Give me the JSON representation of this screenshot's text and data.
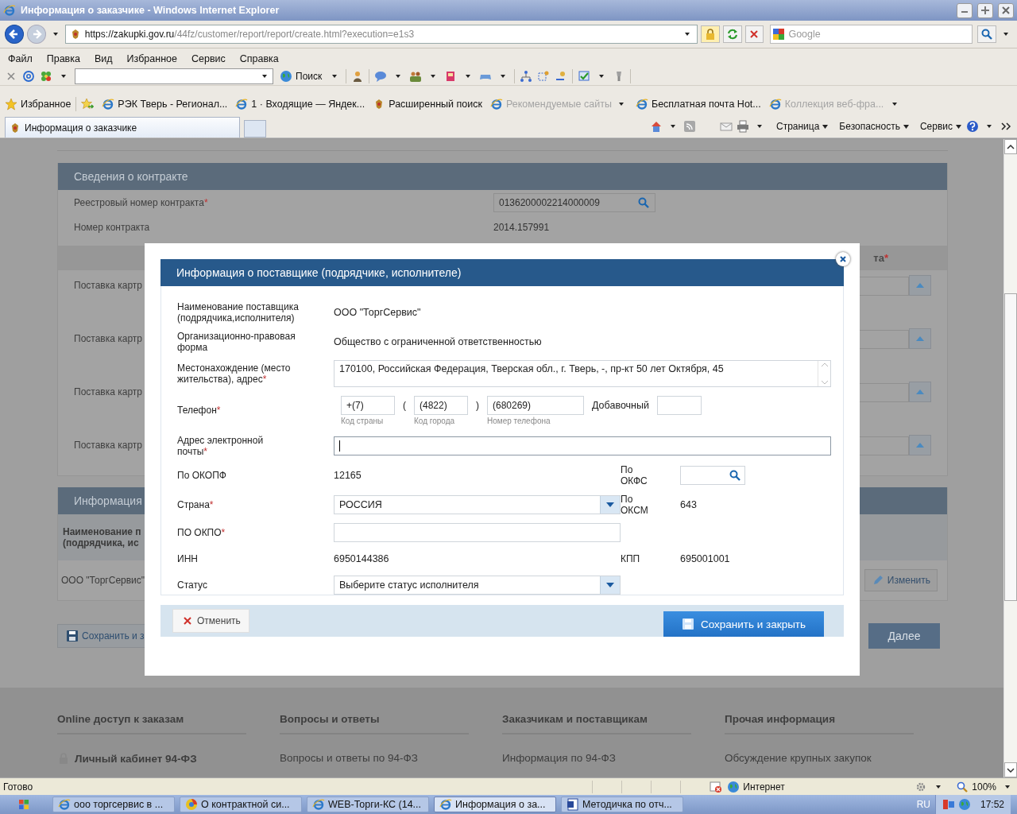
{
  "window": {
    "title": "Информация о заказчике - Windows Internet Explorer"
  },
  "address_bar": {
    "scheme": "https://",
    "host": "zakupki.gov.ru",
    "path": "/44fz/customer/report/report/create.html?execution=e1s3"
  },
  "search_box": {
    "placeholder": "Google"
  },
  "menu": [
    "Файл",
    "Правка",
    "Вид",
    "Избранное",
    "Сервис",
    "Справка"
  ],
  "toolbar": {
    "search_label": "Поиск"
  },
  "favorites_bar": {
    "label": "Избранное",
    "links": [
      {
        "label": "РЭК Тверь - Регионал...",
        "dimmed": false,
        "dropdown": false
      },
      {
        "label": "1 · Входящие — Яндек...",
        "dimmed": false,
        "dropdown": false
      },
      {
        "label": "Расширенный поиск",
        "dimmed": false,
        "dropdown": false
      },
      {
        "label": "Рекомендуемые сайты",
        "dimmed": true,
        "dropdown": true
      },
      {
        "label": "Бесплатная почта Hot...",
        "dimmed": false,
        "dropdown": false
      },
      {
        "label": "Коллекция веб-фра...",
        "dimmed": true,
        "dropdown": false
      }
    ]
  },
  "tabs": [
    {
      "label": "Информация о заказчике",
      "selected": true
    }
  ],
  "command_bar": [
    "Страница",
    "Безопасность",
    "Сервис"
  ],
  "page": {
    "contract_section": {
      "title": "Сведения о контракте",
      "fields": [
        {
          "kind": "search",
          "label": "Реестровый номер контракта",
          "required": "*",
          "value": "0136200002214000009"
        },
        {
          "kind": "text",
          "label": "Номер контракта",
          "value": "2014.157991"
        }
      ]
    },
    "objects_table": {
      "header_fragment": "та",
      "header_required": "*",
      "rows": [
        "Поставка картр",
        "Поставка картр",
        "Поставка картр",
        "Поставка картр"
      ]
    },
    "supplier_section": {
      "title": "Информация",
      "column_1": "Наименование п\n(подрядчика, ис",
      "rows": [
        {
          "supplier": "ООО \"ТоргСервис\"",
          "action": "Изменить"
        }
      ]
    },
    "buttons": {
      "save": "Сохранить и з",
      "next": "Далее"
    },
    "footer": [
      {
        "title": "Online доступ к заказам",
        "link": "Личный кабинет 94-ФЗ",
        "locked": true
      },
      {
        "title": "Вопросы и ответы",
        "link": "Вопросы и ответы по 94-ФЗ",
        "locked": false
      },
      {
        "title": "Заказчикам и поставщикам",
        "link": "Информация по 94-ФЗ",
        "locked": false
      },
      {
        "title": "Прочая информация",
        "link": "Обсуждение крупных закупок",
        "locked": false
      }
    ]
  },
  "supplier_dialog": {
    "title": "Информация о поставщике (подрядчике, исполнителе)",
    "fields": [
      {
        "kind": "text",
        "label": "Наименование поставщика\n(подрядчика,исполнителя)",
        "value": "ООО \"ТоргСервис\""
      },
      {
        "kind": "text",
        "label": "Организационно-правовая\nформа",
        "value": "Общество с ограниченной ответственностью"
      },
      {
        "kind": "textarea",
        "label": "Местонахождение (место\nжительства), адрес",
        "required": "*",
        "value": "170100, Российская Федерация, Тверская обл., г. Тверь, -, пр-кт 50 лет Октября, 45"
      },
      {
        "kind": "phone",
        "label": "Телефон",
        "required": "*",
        "parts": [
          {
            "value": "+(7)",
            "hint": "Код страны"
          },
          {
            "separator": "(",
            "value": "(4822)",
            "hint": "Код города"
          },
          {
            "separator": ")",
            "value": "(680269)",
            "hint": "Номер телефона"
          }
        ],
        "extension_label": "Добавочный"
      },
      {
        "kind": "input",
        "label": "Адрес электронной\nпочты",
        "required": "*",
        "focused": true,
        "wide": true
      },
      {
        "kind": "text",
        "label": "По ОКОПФ",
        "value": "12165",
        "side": {
          "kind": "search",
          "label": "По\nОКФС"
        }
      },
      {
        "kind": "select",
        "label": "Страна",
        "required": "*",
        "value": "РОССИЯ",
        "side": {
          "kind": "text",
          "label": "По\nОКСМ",
          "value": "643"
        }
      },
      {
        "kind": "input",
        "label": "ПО ОКПО",
        "required": "*",
        "focused": false,
        "wide": false
      },
      {
        "kind": "text",
        "label": "ИНН",
        "value": "6950144386",
        "side": {
          "kind": "text",
          "label": "КПП",
          "value": "695001001"
        }
      },
      {
        "kind": "select",
        "label": "Статус",
        "value": "Выберите статус исполнителя"
      }
    ],
    "cancel": "Отменить",
    "save": "Сохранить и закрыть"
  },
  "status_bar": {
    "text": "Готово",
    "zone": "Интернет",
    "zoom": "100%"
  },
  "taskbar": {
    "items": [
      {
        "label": "ооо торгсервис в ...",
        "selected": false
      },
      {
        "label": "О контрактной си...",
        "selected": false
      },
      {
        "label": "WEB-Торги-КС (14...",
        "selected": false
      },
      {
        "label": "Информация о за...",
        "selected": true
      },
      {
        "label": "Методичка по отч...",
        "selected": false
      }
    ],
    "language": "RU",
    "clock": "17:52"
  }
}
